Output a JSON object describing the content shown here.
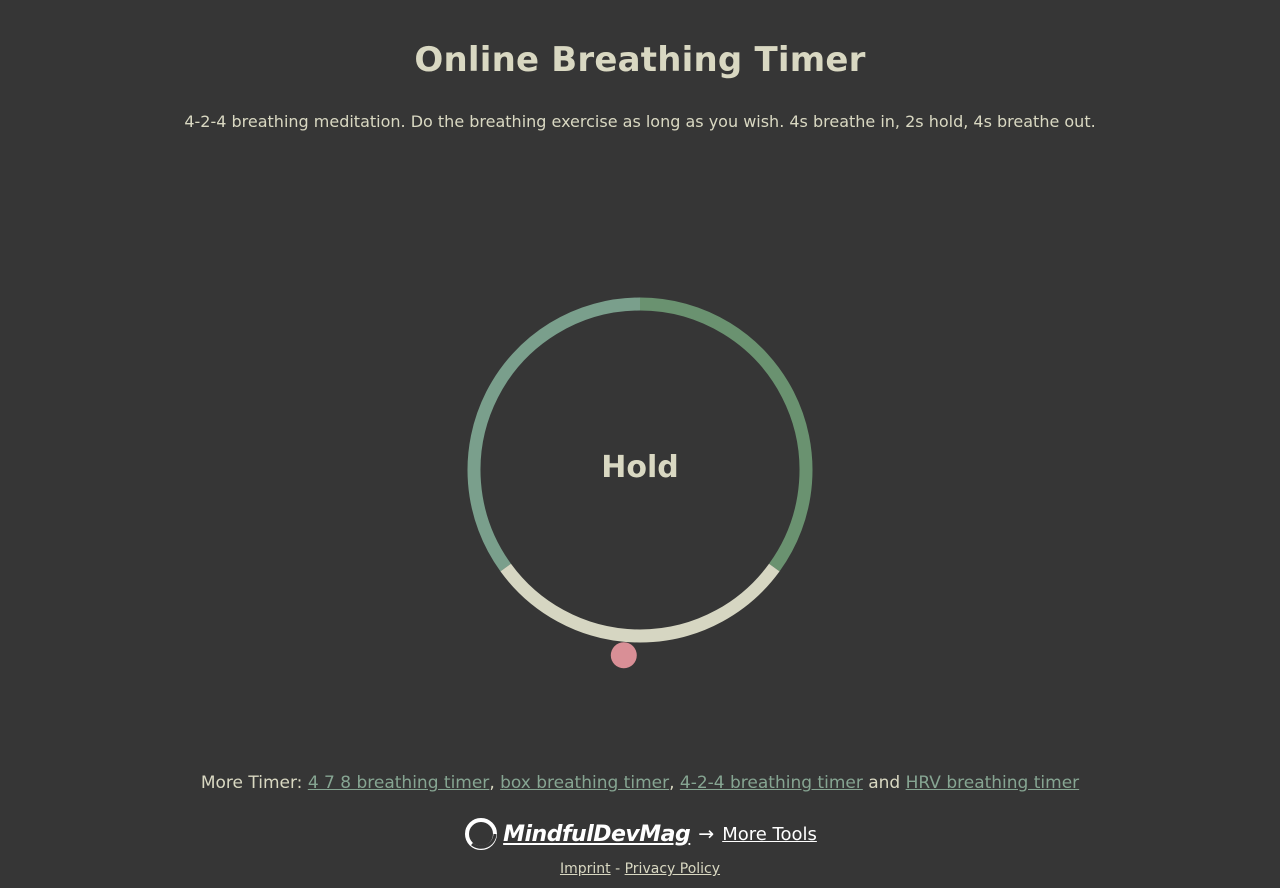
{
  "header": {
    "title": "Online Breathing Timer",
    "description": "4-2-4 breathing meditation. Do the breathing exercise as long as you wish. 4s breathe in, 2s hold, 4s breathe out."
  },
  "timer": {
    "phase_label": "Hold",
    "pattern": [
      "4s breathe in",
      "2s hold",
      "4s breathe out"
    ],
    "colors": {
      "breathe_in": "#7a9f8c",
      "hold": "#d6d6c2",
      "breathe_out": "#6a9270",
      "indicator": "#d98f96"
    }
  },
  "more_timer": {
    "prefix": "More Timer:",
    "links": [
      {
        "label": "4 7 8 breathing timer"
      },
      {
        "label": "box breathing timer"
      },
      {
        "label": "4-2-4 breathing timer"
      },
      {
        "label": "HRV breathing timer"
      }
    ],
    "separator1": ",",
    "separator2": ",",
    "conjunction": "and"
  },
  "footer": {
    "logo_text": "MindfulDevMag",
    "arrow": "→",
    "more_tools": "More Tools",
    "imprint": "Imprint",
    "legal_separator": "-",
    "privacy": "Privacy Policy"
  }
}
